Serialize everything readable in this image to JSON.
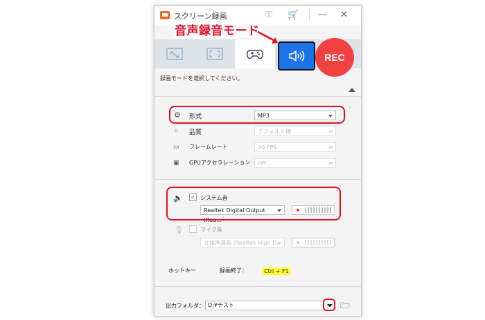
{
  "window": {
    "title": "スクリーン録画",
    "controls": {
      "minimize": "—",
      "close": "✕"
    },
    "header_icons": [
      "key-icon",
      "cart-icon"
    ]
  },
  "modes": {
    "items": [
      "region-capture",
      "fullscreen-capture",
      "game-capture",
      "audio-capture"
    ],
    "selected_index": 2,
    "rec_label": "REC"
  },
  "mode_description": "録画モードを選択してください。",
  "settings": {
    "format": {
      "label": "形式",
      "value": "MP3"
    },
    "quality": {
      "label": "品質",
      "value": "デフォルト値"
    },
    "framerate": {
      "label": "フレームレート",
      "value": "30 FPS"
    },
    "gpu": {
      "label": "GPUアクセラレーション",
      "value": "Off"
    }
  },
  "audio": {
    "system": {
      "label": "システム音",
      "checked": true,
      "device": "Realtek Digital Output (Rea..."
    },
    "mic": {
      "label": "マイク音",
      "checked": false,
      "device": "立体声混音 (Realtek High D..."
    }
  },
  "hotkey": {
    "label": "ホットキー",
    "action": "録画終了：",
    "value": "Ctrl + F1"
  },
  "output": {
    "label": "出力フォルダ：",
    "path": "D:¥テスト"
  },
  "annotation": {
    "callout": "音声録音モード",
    "color": "#e0102a"
  },
  "colors": {
    "accent": "#1a73e8",
    "rec": "#f04040",
    "app": "#ee6a2a"
  }
}
